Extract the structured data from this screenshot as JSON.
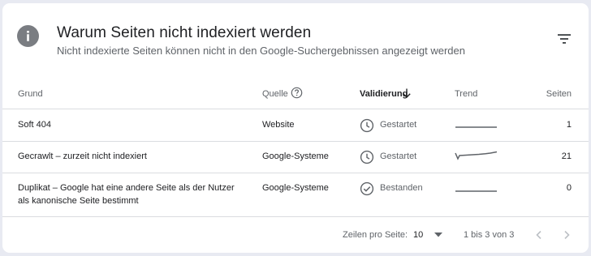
{
  "header": {
    "title": "Warum Seiten nicht indexiert werden",
    "subtitle": "Nicht indexierte Seiten können nicht in den Google-Suchergebnissen angezeigt werden",
    "info_icon": "info-icon",
    "filter_icon": "filter-list-icon"
  },
  "table": {
    "columns": {
      "reason": "Grund",
      "source": "Quelle",
      "validation": "Validierung",
      "trend": "Trend",
      "pages": "Seiten"
    },
    "sort": {
      "column": "validation",
      "direction": "descending"
    },
    "rows": [
      {
        "reason_line1": "Soft 404",
        "reason_line2": "",
        "source": "Website",
        "status": "Gestartet",
        "status_icon": "clock-icon",
        "pages": "1"
      },
      {
        "reason_line1": "Gecrawlt – zurzeit nicht indexiert",
        "reason_line2": "",
        "source": "Google-Systeme",
        "status": "Gestartet",
        "status_icon": "clock-icon",
        "pages": "21"
      },
      {
        "reason_line1": "Duplikat – Google hat eine andere Seite als der Nutzer",
        "reason_line2": "als kanonische Seite bestimmt",
        "source": "Google-Systeme",
        "status": "Bestanden",
        "status_icon": "check-circle-icon",
        "pages": "0"
      }
    ]
  },
  "pagination": {
    "rows_per_page_label": "Zeilen pro Seite:",
    "rows_per_page_value": "10",
    "range_text": "1 bis 3 von 3"
  },
  "colors": {
    "background": "#e8eaf2",
    "text": "#202124",
    "secondary_text": "#5f6368",
    "divider": "#dadce0"
  }
}
